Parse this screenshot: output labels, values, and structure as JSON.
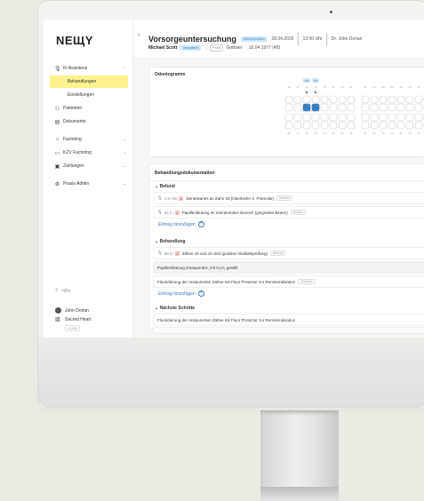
{
  "colors": {
    "accent": "#fef28c",
    "link": "#3a77b4",
    "doc_badge": "#cfe7f7",
    "tooth_selected": "#3a7fc0"
  },
  "sidebar": {
    "logo": "NEЩY",
    "items": [
      {
        "label": "KI Assistenz",
        "icon": "mic-icon"
      },
      {
        "label": "Behandlungen",
        "icon": ""
      },
      {
        "label": "Einstellungen",
        "icon": ""
      },
      {
        "label": "Patienten",
        "icon": "users-icon"
      },
      {
        "label": "Dokumente",
        "icon": "document-icon"
      },
      {
        "label": "Factoring",
        "icon": "bank-icon"
      },
      {
        "label": "KZV Factoring",
        "icon": "card-icon"
      },
      {
        "label": "Zahlungen",
        "icon": "payment-icon"
      },
      {
        "label": "Praxis Admin",
        "icon": "admin-icon"
      }
    ],
    "help": "Hilfe",
    "user_name": "John Dorian",
    "practice": "Sacred Heart",
    "practice_badge": "12345"
  },
  "header": {
    "back": "‹",
    "title": "Vorsorgeuntersuchung",
    "status_badge": "Dokumentation",
    "date": "28.04.2025",
    "time": "13:00 Uhr",
    "doctor": "Dr. John Dorian",
    "patient": "Michael Scott",
    "patient_badge": "Neupatient",
    "insurance_badge": "Privat",
    "insurance": "Gothaer",
    "dob": "15.04.1977 (48)"
  },
  "odontogramm": {
    "title": "Odontogramm",
    "upper_labels": [
      "18",
      "17",
      "16",
      "15",
      "14",
      "13",
      "12",
      "11",
      "21",
      "22",
      "23",
      "24",
      "25",
      "26",
      "27",
      "28"
    ],
    "lower_labels": [
      "48",
      "47",
      "46",
      "45",
      "44",
      "43",
      "42",
      "41",
      "31",
      "32",
      "33",
      "34",
      "35",
      "36",
      "37",
      "38"
    ],
    "selected_labels": [
      "LZD",
      "VZ"
    ],
    "selected_teeth": [
      "15",
      "16"
    ]
  },
  "doc": {
    "title": "Behandlungsdokumentation",
    "befund": {
      "heading": "Befund",
      "entries": [
        {
          "time": "1.5 min",
          "text": "Dentinkaries an Zahn 15 (Oberkiefer 2. Prämolar)",
          "tag": "Befund"
        },
        {
          "time": "24 m",
          "text": "Papillenblutung im Interdentalen Bereich (gingivales Bluten)",
          "tag": "Befund"
        }
      ],
      "add_label": "Eintrag hinzufügen"
    },
    "behandlung": {
      "heading": "Behandlung",
      "entries": [
        {
          "time": "38 m",
          "text": "Zähne 15 und 16 vital (positive Vitalitätsprüfung)",
          "tag": "Befund"
        },
        {
          "time": "",
          "text": "Papillenblutung intraoperativ, mit H₂O₂ gestillt",
          "tag": ""
        },
        {
          "time": "",
          "text": "Fluoridierung der restaurierten Zähne mit Fluor Protector zur Remineralisation",
          "tag": "Therapie"
        }
      ],
      "add_label": "Eintrag hinzufügen"
    },
    "next": {
      "heading": "Nächste Schritte",
      "entries": [
        {
          "text": "Fluoridierung der restaurierten Zähne mit Fluor Protector zur Remineralisation"
        }
      ]
    }
  }
}
